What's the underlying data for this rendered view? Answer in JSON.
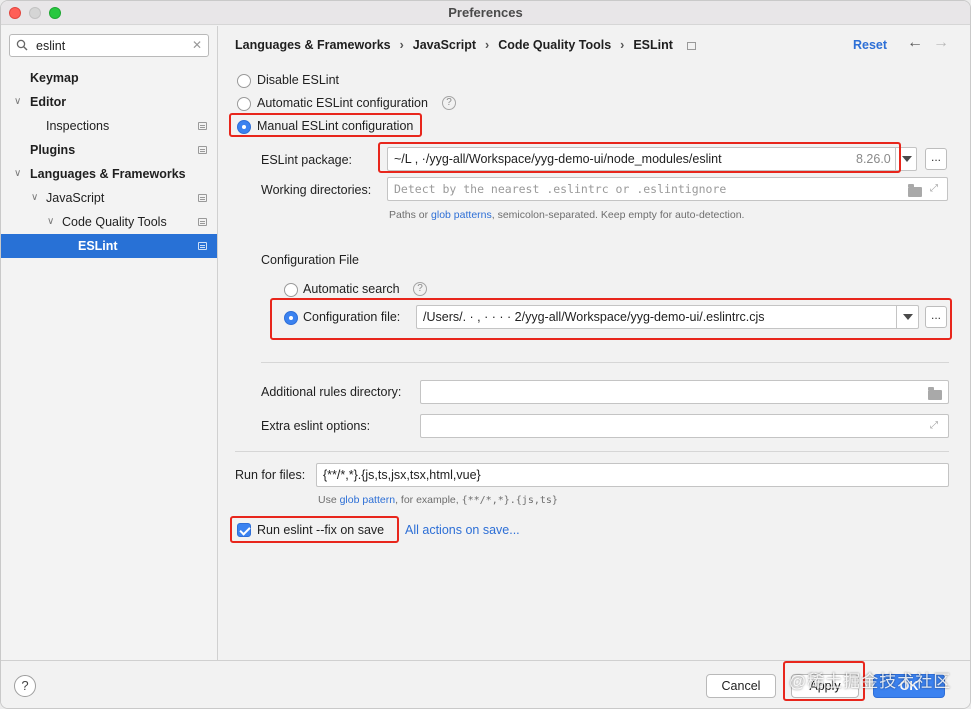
{
  "window": {
    "title": "Preferences"
  },
  "sidebar": {
    "search": {
      "value": "eslint",
      "clear_icon": "close-icon"
    },
    "items": [
      {
        "label": "Keymap",
        "bold": true
      },
      {
        "label": "Editor",
        "bold": true
      },
      {
        "label": "Inspections"
      },
      {
        "label": "Plugins",
        "bold": true
      },
      {
        "label": "Languages & Frameworks",
        "bold": true
      },
      {
        "label": "JavaScript"
      },
      {
        "label": "Code Quality Tools"
      },
      {
        "label": "ESLint",
        "selected": true
      }
    ]
  },
  "breadcrumb": {
    "items": [
      "Languages & Frameworks",
      "JavaScript",
      "Code Quality Tools",
      "ESLint"
    ],
    "separator": "›"
  },
  "header": {
    "reset_label": "Reset",
    "back_icon": "arrow-left-icon",
    "forward_icon": "arrow-right-icon"
  },
  "eslint": {
    "mode_disable": "Disable ESLint",
    "mode_automatic": "Automatic ESLint configuration",
    "mode_manual": "Manual ESLint configuration",
    "selected_mode": "manual",
    "package_label": "ESLint package:",
    "package_value": "~/L          ,    ·/yyg-all/Workspace/yyg-demo-ui/node_modules/eslint",
    "package_version": "8.26.0",
    "workdir_label": "Working directories:",
    "workdir_placeholder": "Detect by the nearest .eslintrc or .eslintignore",
    "workdir_hint_pre": "Paths or ",
    "workdir_hint_link": "glob patterns",
    "workdir_hint_post": ", semicolon-separated. Keep empty for auto-detection.",
    "config_section": "Configuration File",
    "config_auto": "Automatic search",
    "config_file_label": "Configuration file:",
    "config_file_value": "/Users/.   ·  ,  ·  ·  ·   ·  2/yyg-all/Workspace/yyg-demo-ui/.eslintrc.cjs",
    "rules_dir_label": "Additional rules directory:",
    "extra_options_label": "Extra eslint options:",
    "run_for_label": "Run for files:",
    "run_for_value": "{**/*,*}.{js,ts,jsx,tsx,html,vue}",
    "run_hint_pre": "Use ",
    "run_hint_link": "glob pattern",
    "run_hint_mid": ", for example, ",
    "run_hint_example": "{**/*,*}.{js,ts}",
    "fix_on_save_label": "Run eslint --fix on save",
    "fix_on_save_checked": true,
    "all_actions_link": "All actions on save..."
  },
  "footer": {
    "help_label": "?",
    "cancel_label": "Cancel",
    "apply_label": "Apply",
    "ok_label": "OK",
    "watermark": "@稀土掘金技术社区"
  },
  "colors": {
    "accent": "#3b82f0",
    "link": "#2d6fd6",
    "highlight": "#e8261c",
    "selection": "#2871d6"
  }
}
